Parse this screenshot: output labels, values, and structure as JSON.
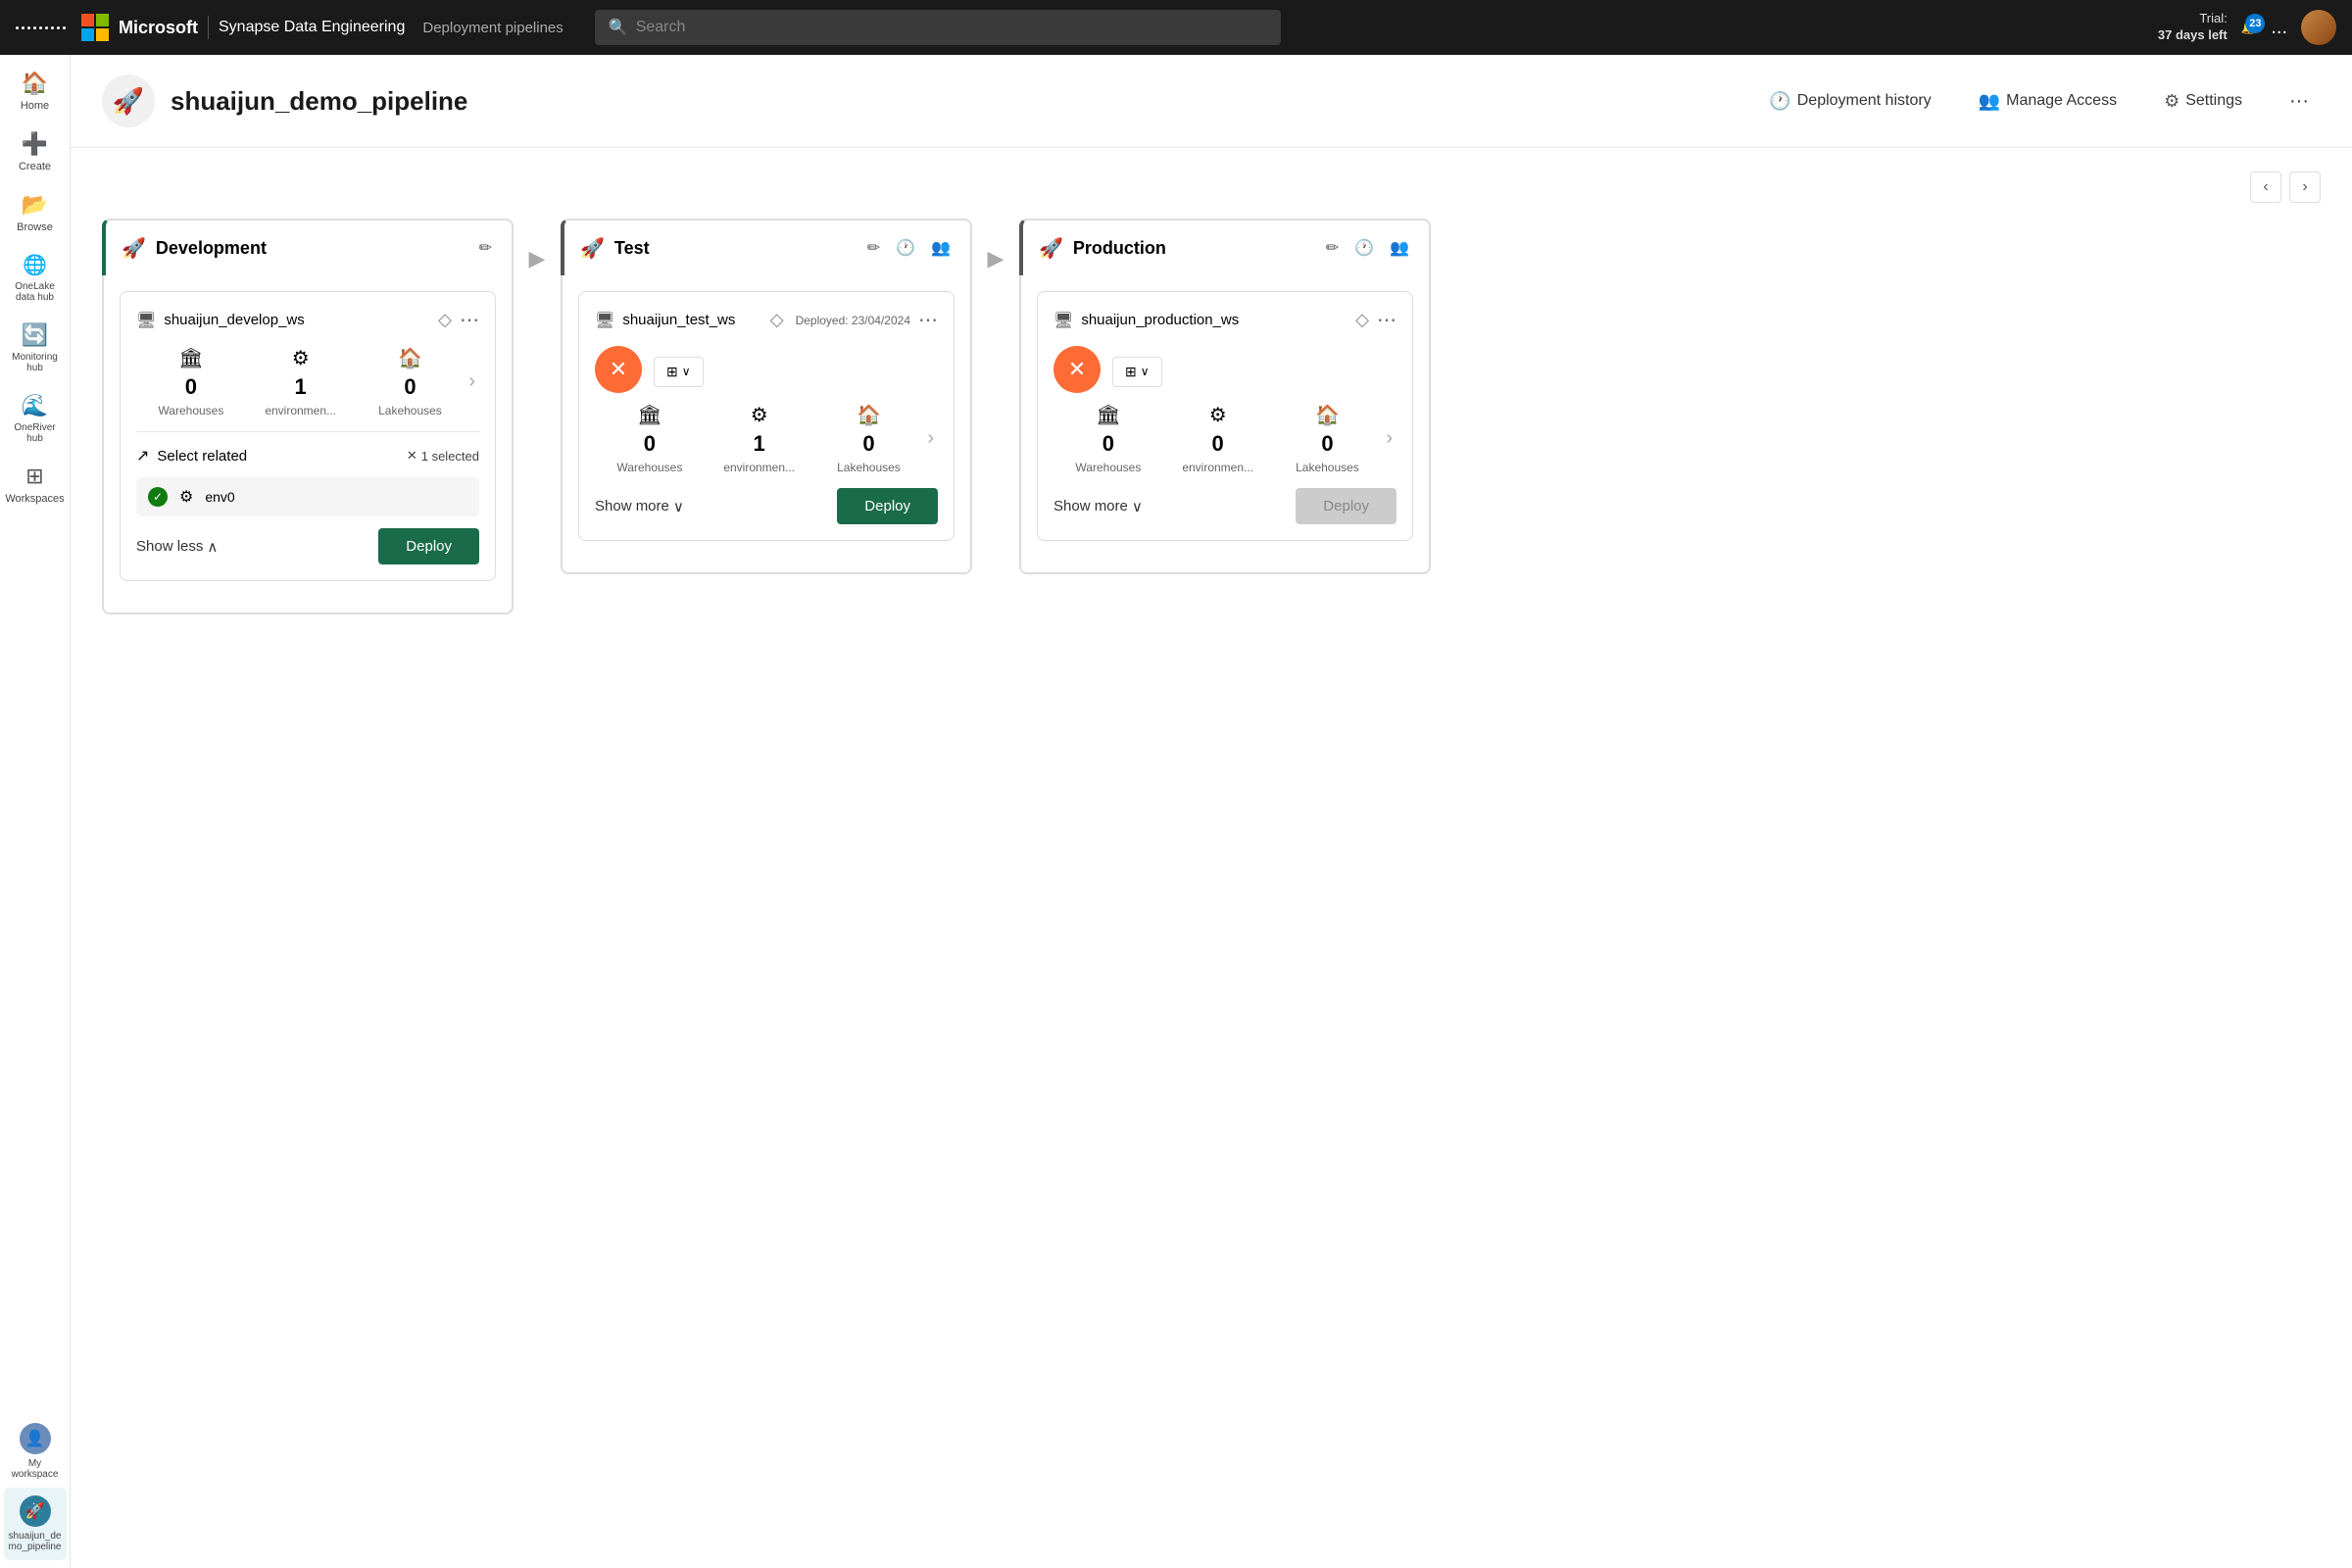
{
  "topnav": {
    "brand": "Microsoft",
    "product": "Synapse Data Engineering",
    "section": "Deployment pipelines",
    "search_placeholder": "Search",
    "trial_label": "Trial:",
    "trial_days": "37 days left",
    "notif_count": "23",
    "more_label": "..."
  },
  "sidebar": {
    "items": [
      {
        "id": "home",
        "label": "Home",
        "icon": "🏠"
      },
      {
        "id": "create",
        "label": "Create",
        "icon": "➕"
      },
      {
        "id": "browse",
        "label": "Browse",
        "icon": "📁"
      },
      {
        "id": "onelake",
        "label": "OneLake data hub",
        "icon": "🌐"
      },
      {
        "id": "monitoring",
        "label": "Monitoring hub",
        "icon": "🔄"
      },
      {
        "id": "oneriver",
        "label": "OneRiver hub",
        "icon": "🌊"
      },
      {
        "id": "workspaces",
        "label": "Workspaces",
        "icon": "⊞"
      },
      {
        "id": "my-workspace",
        "label": "My workspace",
        "icon": "👤"
      },
      {
        "id": "shuaijun-pipeline",
        "label": "shuaijun_de mo_pipeline",
        "icon": "🚀"
      }
    ]
  },
  "page": {
    "icon": "🚀",
    "title": "shuaijun_demo_pipeline",
    "actions": {
      "deployment_history": "Deployment history",
      "manage_access": "Manage Access",
      "settings": "Settings"
    }
  },
  "stages": [
    {
      "id": "development",
      "name": "Development",
      "workspace": "shuaijun_develop_ws",
      "workspace_icon": "🖥",
      "diamond_icon": "◇",
      "deployed_text": "",
      "stats": [
        {
          "icon": "🏛",
          "value": "0",
          "label": "Warehouses"
        },
        {
          "icon": "⚙",
          "value": "1",
          "label": "environmen..."
        },
        {
          "icon": "🏠",
          "value": "0",
          "label": "Lakehouses"
        }
      ],
      "has_select_related": true,
      "select_related_label": "Select related",
      "selected_count": "1 selected",
      "env_item": "env0",
      "show_label": "Show less",
      "deploy_label": "Deploy",
      "deploy_disabled": false,
      "header_btns": [
        "✏"
      ]
    },
    {
      "id": "test",
      "name": "Test",
      "workspace": "shuaijun_test_ws",
      "workspace_icon": "🖥",
      "diamond_icon": "◇",
      "deployed_text": "Deployed: 23/04/2024",
      "stats": [
        {
          "icon": "🏛",
          "value": "0",
          "label": "Warehouses"
        },
        {
          "icon": "⚙",
          "value": "1",
          "label": "environmen..."
        },
        {
          "icon": "🏠",
          "value": "0",
          "label": "Lakehouses"
        }
      ],
      "has_select_related": false,
      "show_label": "Show more",
      "deploy_label": "Deploy",
      "deploy_disabled": false,
      "header_btns": [
        "✏",
        "🕐",
        "👥"
      ]
    },
    {
      "id": "production",
      "name": "Production",
      "workspace": "shuaijun_production_ws",
      "workspace_icon": "🖥",
      "diamond_icon": "◇",
      "deployed_text": "",
      "stats": [
        {
          "icon": "🏛",
          "value": "0",
          "label": "Warehouses"
        },
        {
          "icon": "⚙",
          "value": "0",
          "label": "environmen..."
        },
        {
          "icon": "🏠",
          "value": "0",
          "label": "Lakehouses"
        }
      ],
      "has_select_related": false,
      "show_label": "Show more",
      "deploy_label": "Deploy",
      "deploy_disabled": true,
      "header_btns": [
        "✏",
        "🕐",
        "👥"
      ]
    }
  ]
}
